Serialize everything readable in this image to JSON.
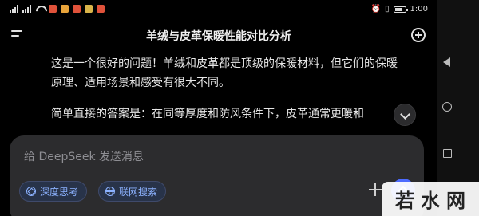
{
  "status_bar": {
    "time": "1:00",
    "battery_level": 0.7,
    "icons": [
      "signal-icon",
      "wifi-icon",
      "app-notification-icon",
      "alarm-icon",
      "vibrate-icon"
    ]
  },
  "header": {
    "title": "羊绒与皮革保暖性能对比分析",
    "menu_icon": "menu-icon",
    "new_chat_icon": "new-chat-icon"
  },
  "chat": {
    "paragraphs": [
      "这是一个很好的问题！羊绒和皮革都是顶级的保暖材料，但它们的保暖原理、适用场景和感受有很大不同。",
      "简单直接的答案是：在同等厚度和防风条件下，皮革通常更暖和"
    ]
  },
  "composer": {
    "placeholder": "给 DeepSeek 发送消息",
    "deep_think_label": "深度思考",
    "web_search_label": "联网搜索"
  },
  "watermark": {
    "chars": [
      "若",
      "水",
      "网"
    ]
  },
  "colors": {
    "accent": "#4d6bfe",
    "chip_text": "#8cb2ff",
    "background": "#000000",
    "composer_bg": "#2c2c2e"
  }
}
